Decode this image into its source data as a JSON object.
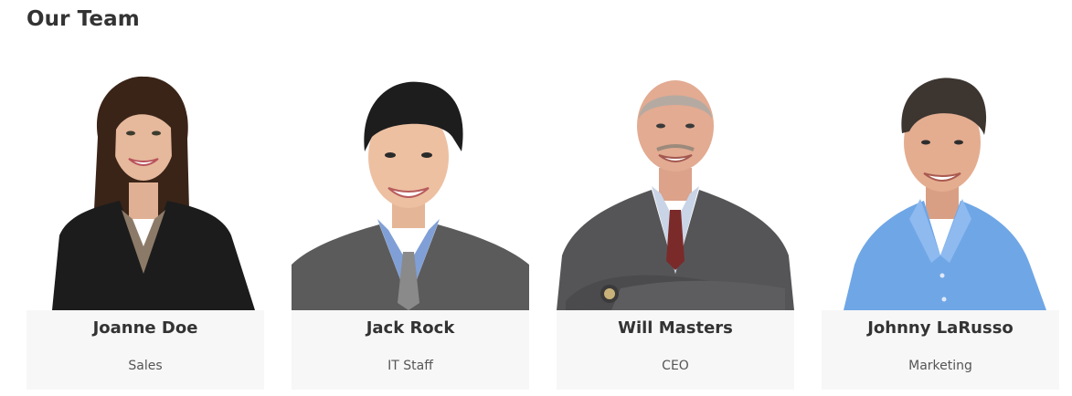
{
  "section": {
    "title": "Our Team"
  },
  "team": [
    {
      "name": "Joanne Doe",
      "role": "Sales",
      "photo_icon": "portrait-woman-black-blazer"
    },
    {
      "name": "Jack Rock",
      "role": "IT Staff",
      "photo_icon": "portrait-man-gray-suit"
    },
    {
      "name": "Will Masters",
      "role": "CEO",
      "photo_icon": "portrait-man-arms-crossed"
    },
    {
      "name": "Johnny LaRusso",
      "role": "Marketing",
      "photo_icon": "portrait-man-blue-shirt"
    }
  ],
  "colors": {
    "card_background": "#f7f7f7",
    "heading_text": "#333333",
    "role_text": "#555555"
  }
}
